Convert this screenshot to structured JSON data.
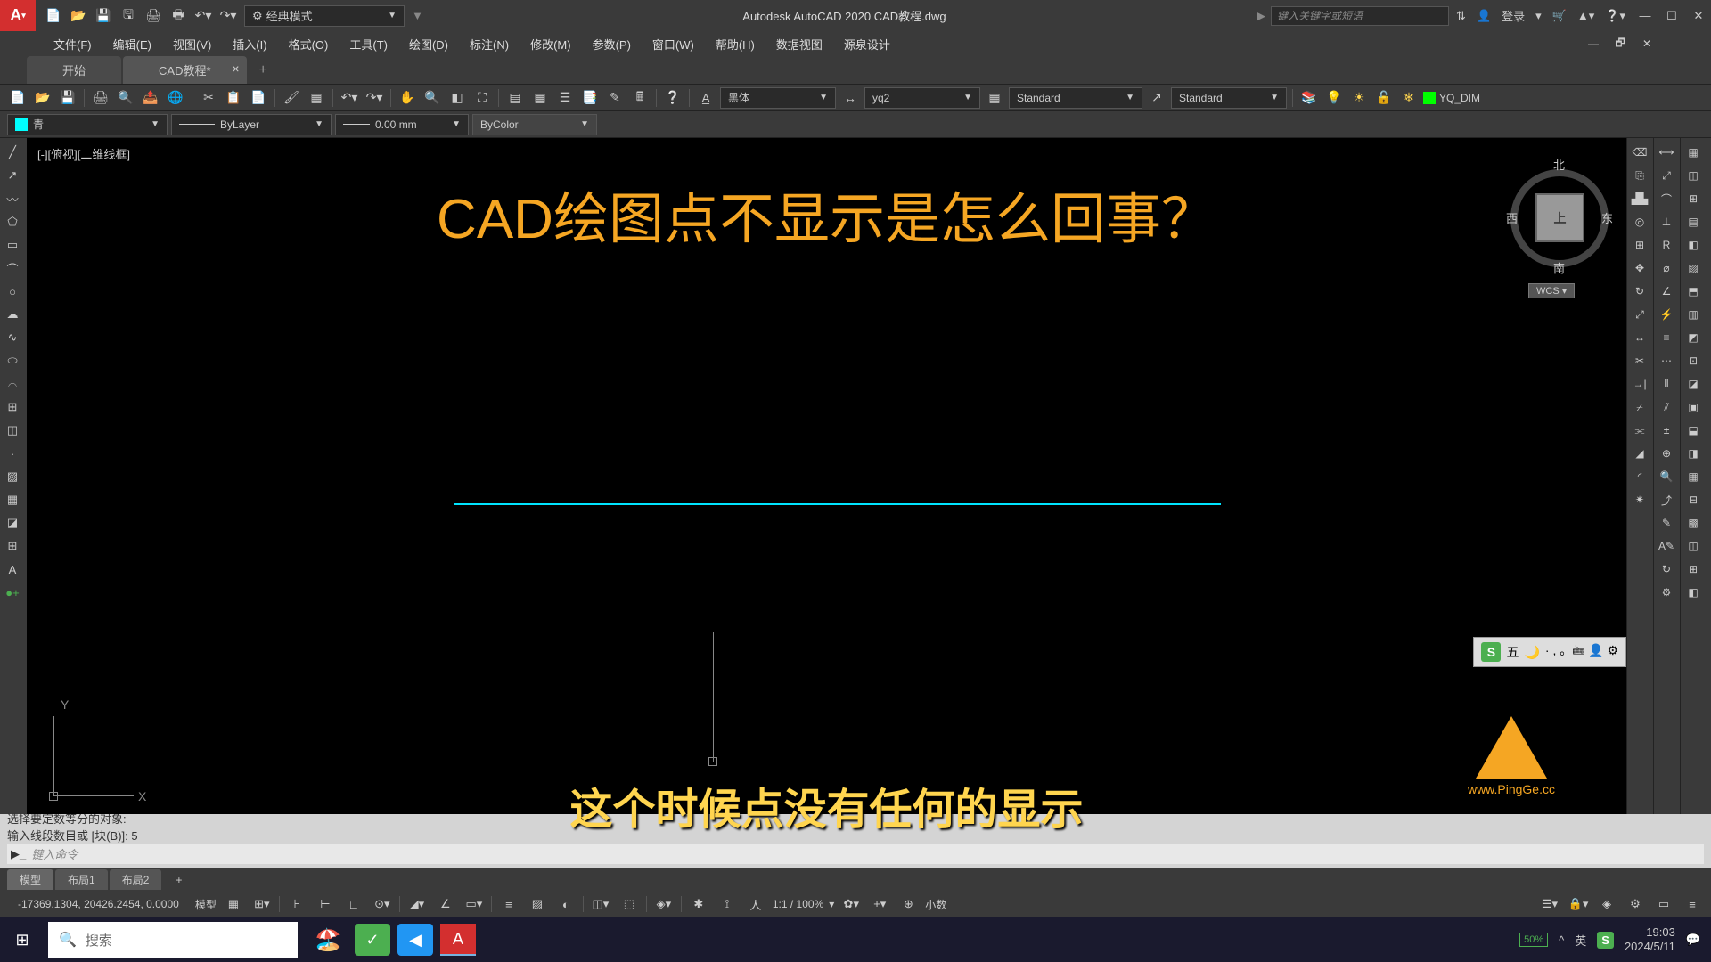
{
  "app": {
    "title": "Autodesk AutoCAD 2020   CAD教程.dwg",
    "icon_letter": "A",
    "search_placeholder": "键入关键字或短语",
    "login": "登录",
    "workspace": "经典模式"
  },
  "menu": {
    "file": "文件(F)",
    "edit": "编辑(E)",
    "view": "视图(V)",
    "insert": "插入(I)",
    "format": "格式(O)",
    "tools": "工具(T)",
    "draw": "绘图(D)",
    "dimension": "标注(N)",
    "modify": "修改(M)",
    "param": "参数(P)",
    "window": "窗口(W)",
    "help": "帮助(H)",
    "data": "数据视图",
    "source": "源泉设计"
  },
  "tabs": {
    "start": "开始",
    "doc": "CAD教程*"
  },
  "props": {
    "layer_color": "青",
    "linetype": "ByLayer",
    "lineweight": "0.00 mm",
    "bycolor": "ByColor",
    "font": "黑体",
    "style1": "yq2",
    "style2": "Standard",
    "style3": "Standard",
    "dimlayer": "YQ_DIM"
  },
  "canvas": {
    "viewlabel": "[-][俯视][二维线框]",
    "title": "CAD绘图点不显示是怎么回事？",
    "subtitle": "这个时候点没有任何的显示",
    "ucs_x": "X",
    "ucs_y": "Y",
    "viewcube": {
      "top": "上",
      "n": "北",
      "s": "南",
      "e": "东",
      "w": "西",
      "wcs": "WCS"
    },
    "logo_url": "www.PingGe.cc"
  },
  "ime": {
    "mode": "五",
    "items": "· , 。🖮 👤 ⚙"
  },
  "cmd": {
    "line1": "选择要定数等分的对象:",
    "line2": "输入线段数目或 [块(B)]: 5",
    "placeholder": "键入命令"
  },
  "layouts": {
    "model": "模型",
    "l1": "布局1",
    "l2": "布局2"
  },
  "status": {
    "coords": "-17369.1304, 20426.2454, 0.0000",
    "model": "模型",
    "scale": "1:1 / 100%",
    "decimal": "小数"
  },
  "taskbar": {
    "search": "搜索",
    "battery": "50%",
    "ime1": "英",
    "time": "19:03",
    "date": "2024/5/11"
  }
}
